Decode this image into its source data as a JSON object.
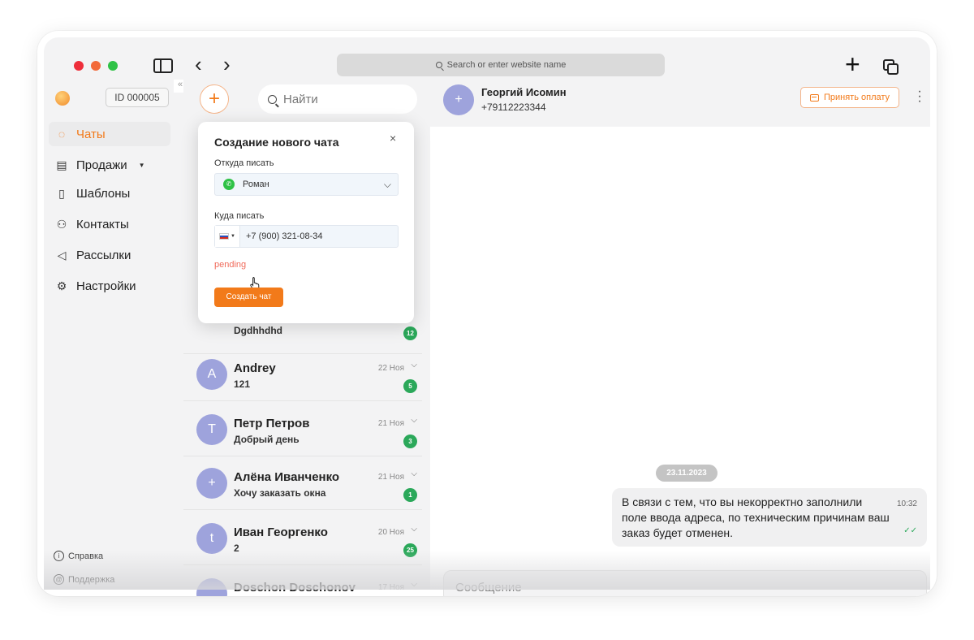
{
  "browser": {
    "url_placeholder": "Search or enter website name",
    "back_glyph": "‹",
    "forward_glyph": "›",
    "new_tab_glyph": "+",
    "icons": [
      "sidebar-toggle-icon",
      "back-icon",
      "forward-icon",
      "search-icon",
      "plus-icon",
      "tabs-icon"
    ]
  },
  "sidebar": {
    "account_id": "ID 000005",
    "collapse_glyph": "«",
    "items": [
      {
        "label": "Чаты",
        "icon": "chats-icon",
        "glyph": "◌"
      },
      {
        "label": "Продажи",
        "icon": "store-icon",
        "glyph": "▤"
      },
      {
        "label": "Шаблоны",
        "icon": "document-icon",
        "glyph": "▯"
      },
      {
        "label": "Контакты",
        "icon": "contacts-icon",
        "glyph": "⚇"
      },
      {
        "label": "Рассылки",
        "icon": "megaphone-icon",
        "glyph": "◁"
      },
      {
        "label": "Настройки",
        "icon": "gear-icon",
        "glyph": "⚙"
      }
    ],
    "footer": [
      {
        "label": "Справка",
        "icon": "info-icon",
        "glyph": "i"
      },
      {
        "label": "Поддержка",
        "icon": "support-icon",
        "glyph": "@"
      }
    ]
  },
  "chat_list": {
    "fab_glyph": "+",
    "search_placeholder": "Найти",
    "hidden_row_preview": "Dgdhhdhd",
    "hidden_row_count": "12",
    "rows": [
      {
        "initial": "A",
        "name": "Andrey",
        "preview": "121",
        "date": "22 Ноя",
        "count": "5"
      },
      {
        "initial": "T",
        "name": "Петр Петров",
        "preview": "Добрый день",
        "date": "21 Ноя",
        "count": "3"
      },
      {
        "initial": "+",
        "name": "Алёна Иванченко",
        "preview": "Хочу заказать окна",
        "date": "21 Ноя",
        "count": "1"
      },
      {
        "initial": "t",
        "name": "Иван Георгенко",
        "preview": "2",
        "date": "20 Ноя",
        "count": "25"
      },
      {
        "initial": "",
        "name": "Doschon Doschonov",
        "preview": "",
        "date": "17 Ноя",
        "count": ""
      }
    ]
  },
  "conversation": {
    "contact_initial": "+",
    "contact_name": "Георгий Исомин",
    "contact_phone": "+79112223344",
    "accept_payment_label": "Принять оплату",
    "date_separator": "23.11.2023",
    "message": {
      "text": "В связи с тем, что вы некорректно заполнили поле ввода адреса, по техническим причинам ваш заказ будет отменен.",
      "time": "10:32",
      "status_glyph": "✓✓"
    },
    "composer_placeholder": "Сообщение"
  },
  "new_chat_modal": {
    "title": "Создание нового чата",
    "close_glyph": "×",
    "from_label": "Откуда писать",
    "from_value": "Роман",
    "to_label": "Куда писать",
    "phone_value": "+7 (900) 321-08-34",
    "status_text": "pending",
    "create_label": "Создать чат"
  },
  "colors": {
    "accent": "#f27a1a",
    "avatar": "#9ea3dc",
    "badge_green": "#2ba85a",
    "pending_red": "#f06a5a"
  }
}
